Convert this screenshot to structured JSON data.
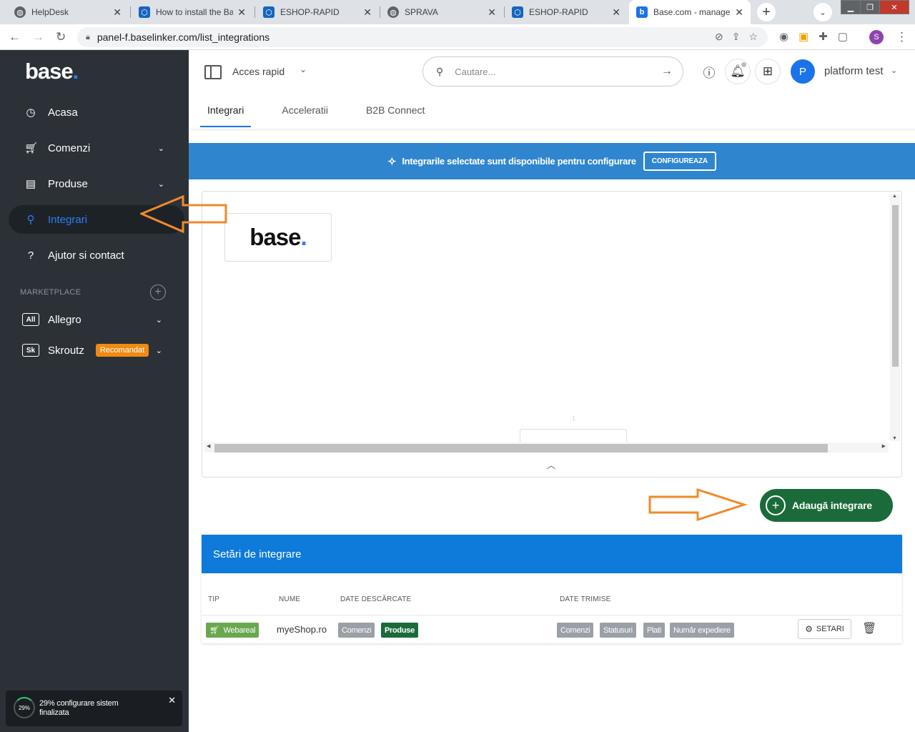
{
  "browser": {
    "tabs": [
      {
        "title": "HelpDesk",
        "icon": "globe-icon"
      },
      {
        "title": "How to install the Ba",
        "icon": "hexagon-icon"
      },
      {
        "title": "ESHOP-RAPID",
        "icon": "hexagon-icon"
      },
      {
        "title": "SPRAVA",
        "icon": "globe-icon"
      },
      {
        "title": "ESHOP-RAPID",
        "icon": "hexagon-icon"
      },
      {
        "title": "Base.com - managem",
        "icon": "base-favicon-icon"
      }
    ],
    "url": "panel-f.baselinker.com/list_integrations",
    "profile_initial": "S"
  },
  "sidebar": {
    "logo": "base",
    "items": [
      {
        "label": "Acasa",
        "icon": "dashboard-icon"
      },
      {
        "label": "Comenzi",
        "icon": "cart-icon"
      },
      {
        "label": "Produse",
        "icon": "products-icon"
      },
      {
        "label": "Integrari",
        "icon": "plug-icon"
      },
      {
        "label": "Ajutor si contact",
        "icon": "help-icon"
      }
    ],
    "marketplace_label": "MARKETPLACE",
    "marketplaces": [
      {
        "code": "All",
        "label": "Allegro"
      },
      {
        "code": "Sk",
        "label": "Skroutz",
        "badge": "Recomandat"
      }
    ],
    "progress": {
      "percent": "29%",
      "text": "29% configurare sistem finalizata"
    }
  },
  "header": {
    "quick_access": "Acces rapid",
    "search_placeholder": "Cautare...",
    "user_initial": "P",
    "user_name": "platform test",
    "tabs": [
      "Integrari",
      "Acceleratii",
      "B2B Connect"
    ]
  },
  "banner": {
    "text": "Integrarile selectate sunt disponibile pentru configurare",
    "button": "CONFIGUREAZA"
  },
  "canvas": {
    "card_logo": "base"
  },
  "add_button": "Adaugă integrare",
  "settings": {
    "title": "Setări de integrare",
    "columns": [
      "TIP",
      "NUME",
      "DATE DESCĂRCATE",
      "DATE TRIMISE"
    ],
    "row": {
      "type": "Webareal",
      "name": "myeShop.ro",
      "downloaded": [
        "Comenzi",
        "Produse"
      ],
      "sent": [
        "Comenzi",
        "Statusuri",
        "Plati",
        "Număr expediere"
      ],
      "settings_button": "SETARI"
    }
  },
  "colors": {
    "sidebar_bg": "#2b3137",
    "accent": "#1a73e8",
    "banner": "#2f86cf",
    "add_button": "#1b6b3a",
    "annotation_arrow": "#f08a2a"
  }
}
